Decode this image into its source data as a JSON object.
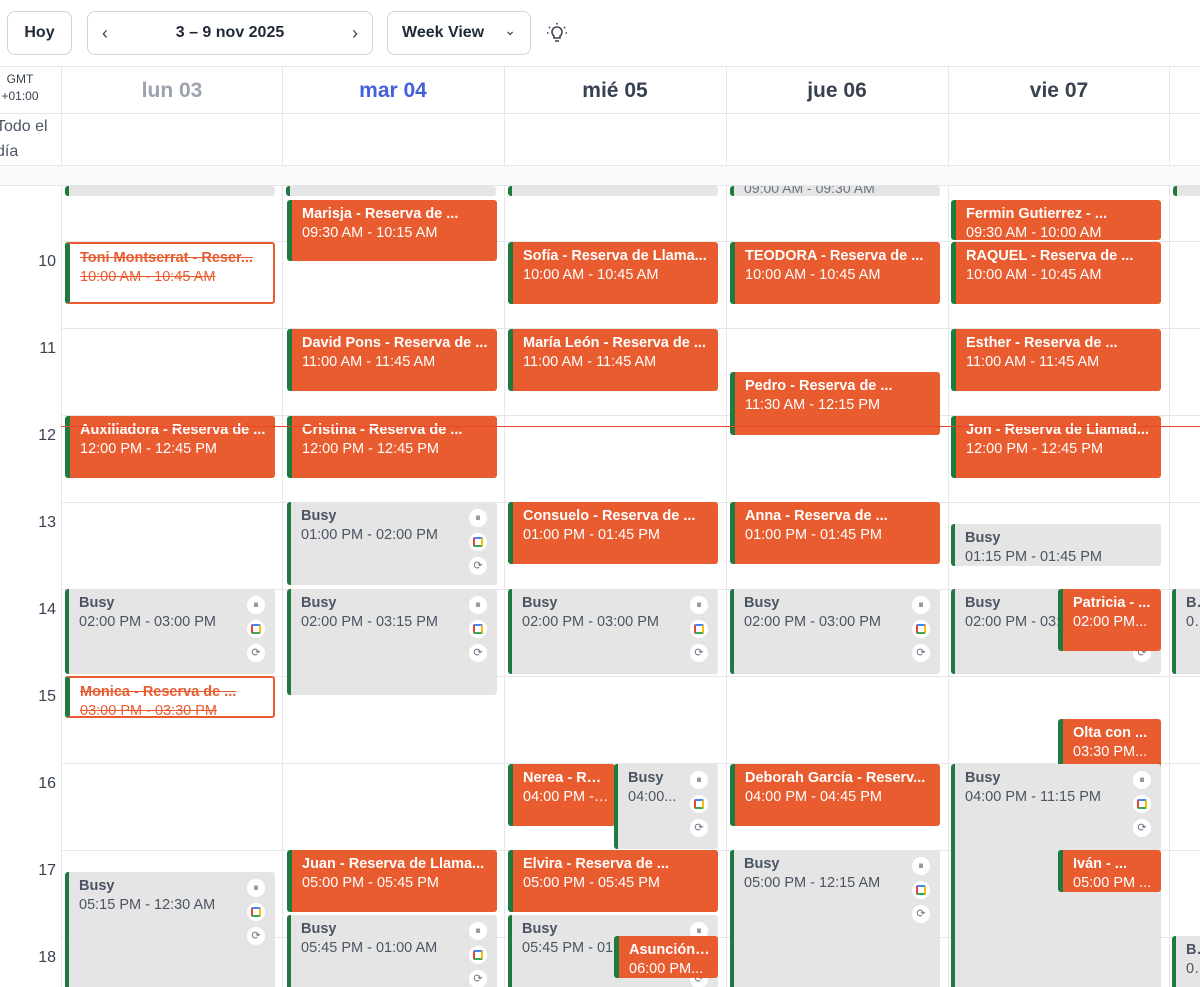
{
  "toolbar": {
    "today_label": "Hoy",
    "prev_icon": "‹",
    "next_icon": "›",
    "date_range": "3 – 9 nov 2025",
    "view_label": "Week View",
    "view_chevron": "⌄",
    "theme_icon": "lightbulb-icon"
  },
  "header": {
    "tz_line1": "GMT",
    "tz_line2": "+01:00",
    "days": [
      {
        "label": "lun 03",
        "color": "#9ca3af"
      },
      {
        "label": "mar 04",
        "color": "#4361d8"
      },
      {
        "label": "mié 05",
        "color": "#374151"
      },
      {
        "label": "jue 06",
        "color": "#374151"
      },
      {
        "label": "vie 07",
        "color": "#374151"
      }
    ],
    "allday_label": "Todo el día"
  },
  "hours": [
    "10",
    "11",
    "12",
    "13",
    "14",
    "15",
    "16",
    "17",
    "18"
  ],
  "events": [
    {
      "day": 1,
      "kind": "res",
      "title": "Marisja - Reserva de ...",
      "time": "09:30 AM - 10:15 AM"
    },
    {
      "day": 4,
      "kind": "res",
      "title": "Fermin Gutierrez - ...",
      "time": "09:30 AM - 10:00 AM"
    },
    {
      "day": 3,
      "kind": "stub-text",
      "title": "09:00 AM - 09:30 AM"
    },
    {
      "day": 0,
      "kind": "cancel",
      "title": "Toni Montserrat - Reser...",
      "time": "10:00 AM - 10:45 AM"
    },
    {
      "day": 2,
      "kind": "res",
      "title": "Sofía - Reserva de Llama...",
      "time": "10:00 AM - 10:45 AM"
    },
    {
      "day": 3,
      "kind": "res",
      "title": "TEODORA - Reserva de ...",
      "time": "10:00 AM - 10:45 AM"
    },
    {
      "day": 4,
      "kind": "res",
      "title": "RAQUEL - Reserva de ...",
      "time": "10:00 AM - 10:45 AM"
    },
    {
      "day": 1,
      "kind": "res",
      "title": "David Pons - Reserva de ...",
      "time": "11:00 AM - 11:45 AM"
    },
    {
      "day": 2,
      "kind": "res",
      "title": "María León - Reserva de ...",
      "time": "11:00 AM - 11:45 AM"
    },
    {
      "day": 4,
      "kind": "res",
      "title": "Esther - Reserva de ...",
      "time": "11:00 AM - 11:45 AM"
    },
    {
      "day": 3,
      "kind": "res",
      "title": "Pedro - Reserva de ...",
      "time": "11:30 AM - 12:15 PM"
    },
    {
      "day": 0,
      "kind": "res",
      "title": "Auxiliadora - Reserva de ...",
      "time": "12:00 PM - 12:45 PM"
    },
    {
      "day": 1,
      "kind": "res",
      "title": "Cristina - Reserva de ...",
      "time": "12:00 PM - 12:45 PM"
    },
    {
      "day": 4,
      "kind": "res",
      "title": "Jon - Reserva de Llamad...",
      "time": "12:00 PM - 12:45 PM"
    },
    {
      "day": 1,
      "kind": "busy",
      "title": "Busy",
      "time": "01:00 PM - 02:00 PM"
    },
    {
      "day": 2,
      "kind": "res",
      "title": "Consuelo - Reserva de ...",
      "time": "01:00 PM - 01:45 PM"
    },
    {
      "day": 3,
      "kind": "res",
      "title": "Anna - Reserva de ...",
      "time": "01:00 PM - 01:45 PM"
    },
    {
      "day": 4,
      "kind": "busy-plain",
      "title": "Busy",
      "time": "01:15 PM - 01:45 PM"
    },
    {
      "day": 0,
      "kind": "busy",
      "title": "Busy",
      "time": "02:00 PM - 03:00 PM"
    },
    {
      "day": 1,
      "kind": "busy",
      "title": "Busy",
      "time": "02:00 PM - 03:15 PM"
    },
    {
      "day": 2,
      "kind": "busy",
      "title": "Busy",
      "time": "02:00 PM - 03:00 PM"
    },
    {
      "day": 3,
      "kind": "busy",
      "title": "Busy",
      "time": "02:00 PM - 03:00 PM"
    },
    {
      "day": 4,
      "kind": "busy",
      "title": "Busy",
      "time": "02:00 PM - 03:00 PM"
    },
    {
      "day": 4,
      "kind": "res",
      "title": "Patricia - ...",
      "time": "02:00 PM..."
    },
    {
      "day": 0,
      "kind": "cancel",
      "title": "Monica - Reserva de ...",
      "time": "03:00 PM - 03:30 PM"
    },
    {
      "day": 4,
      "kind": "res",
      "title": "Olta con ...",
      "time": "03:30 PM..."
    },
    {
      "day": 2,
      "kind": "res",
      "title": "Nerea - Rese...",
      "time": "04:00 PM - 04:..."
    },
    {
      "day": 2,
      "kind": "busy",
      "title": "Busy",
      "time": "04:00..."
    },
    {
      "day": 3,
      "kind": "res",
      "title": "Deborah García - Reserv...",
      "time": "04:00 PM - 04:45 PM"
    },
    {
      "day": 4,
      "kind": "busy",
      "title": "Busy",
      "time": "04:00 PM - 11:15 PM"
    },
    {
      "day": 0,
      "kind": "busy",
      "title": "Busy",
      "time": "05:15 PM - 12:30 AM"
    },
    {
      "day": 1,
      "kind": "res",
      "title": "Juan - Reserva de Llama...",
      "time": "05:00 PM - 05:45 PM"
    },
    {
      "day": 2,
      "kind": "res",
      "title": "Elvira - Reserva de ...",
      "time": "05:00 PM - 05:45 PM"
    },
    {
      "day": 3,
      "kind": "busy",
      "title": "Busy",
      "time": "05:00 PM - 12:15 AM"
    },
    {
      "day": 4,
      "kind": "res",
      "title": "Iván - ...",
      "time": "05:00 PM ..."
    },
    {
      "day": 1,
      "kind": "busy",
      "title": "Busy",
      "time": "05:45 PM - 01:00 AM"
    },
    {
      "day": 2,
      "kind": "busy",
      "title": "Busy",
      "time": "05:45 PM - 01:..."
    },
    {
      "day": 2,
      "kind": "res",
      "title": "Asunción - ...",
      "time": "06:00 PM..."
    },
    {
      "day": 5,
      "kind": "busy-partial",
      "title": "Bu",
      "time": "02"
    },
    {
      "day": 5,
      "kind": "busy-partial",
      "title": "Bu",
      "time": "06"
    }
  ]
}
